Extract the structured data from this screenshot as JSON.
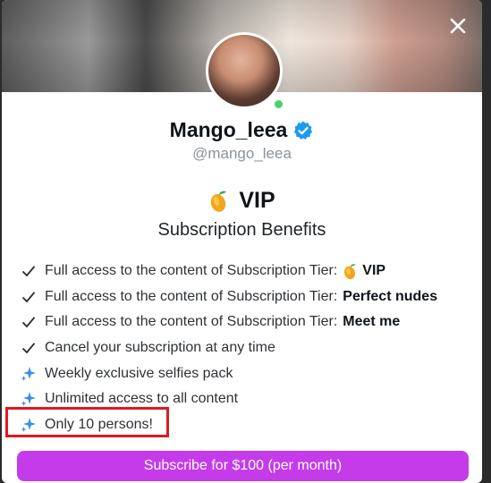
{
  "profile": {
    "name": "Mango_leea",
    "handle": "@mango_leea",
    "online": true
  },
  "tier": {
    "emoji_icon": "mango-icon",
    "name": "VIP"
  },
  "benefits": {
    "title": "Subscription Benefits",
    "items": [
      {
        "icon": "check-icon",
        "text": "Full access to the content of Subscription Tier:",
        "value": "VIP",
        "value_icon": "mango-icon"
      },
      {
        "icon": "check-icon",
        "text": "Full access to the content of Subscription Tier:",
        "value": "Perfect nudes"
      },
      {
        "icon": "check-icon",
        "text": "Full access to the content of Subscription Tier:",
        "value": "Meet me"
      },
      {
        "icon": "check-icon",
        "text": "Cancel your subscription at any time"
      },
      {
        "icon": "sparkle-icon",
        "text": "Weekly exclusive selfies pack"
      },
      {
        "icon": "sparkle-icon",
        "text": "Unlimited access to all content"
      },
      {
        "icon": "sparkle-icon",
        "text": "Only 10 persons!"
      }
    ]
  },
  "subscribe_button": {
    "label": "Subscribe for $100 (per month)"
  },
  "colors": {
    "accent": "#c53bea",
    "verified": "#1d9bf0",
    "online": "#4cd06a",
    "highlight": "#e0191f",
    "sparkle": "#3a8ee6"
  },
  "close_icon": "close-icon"
}
